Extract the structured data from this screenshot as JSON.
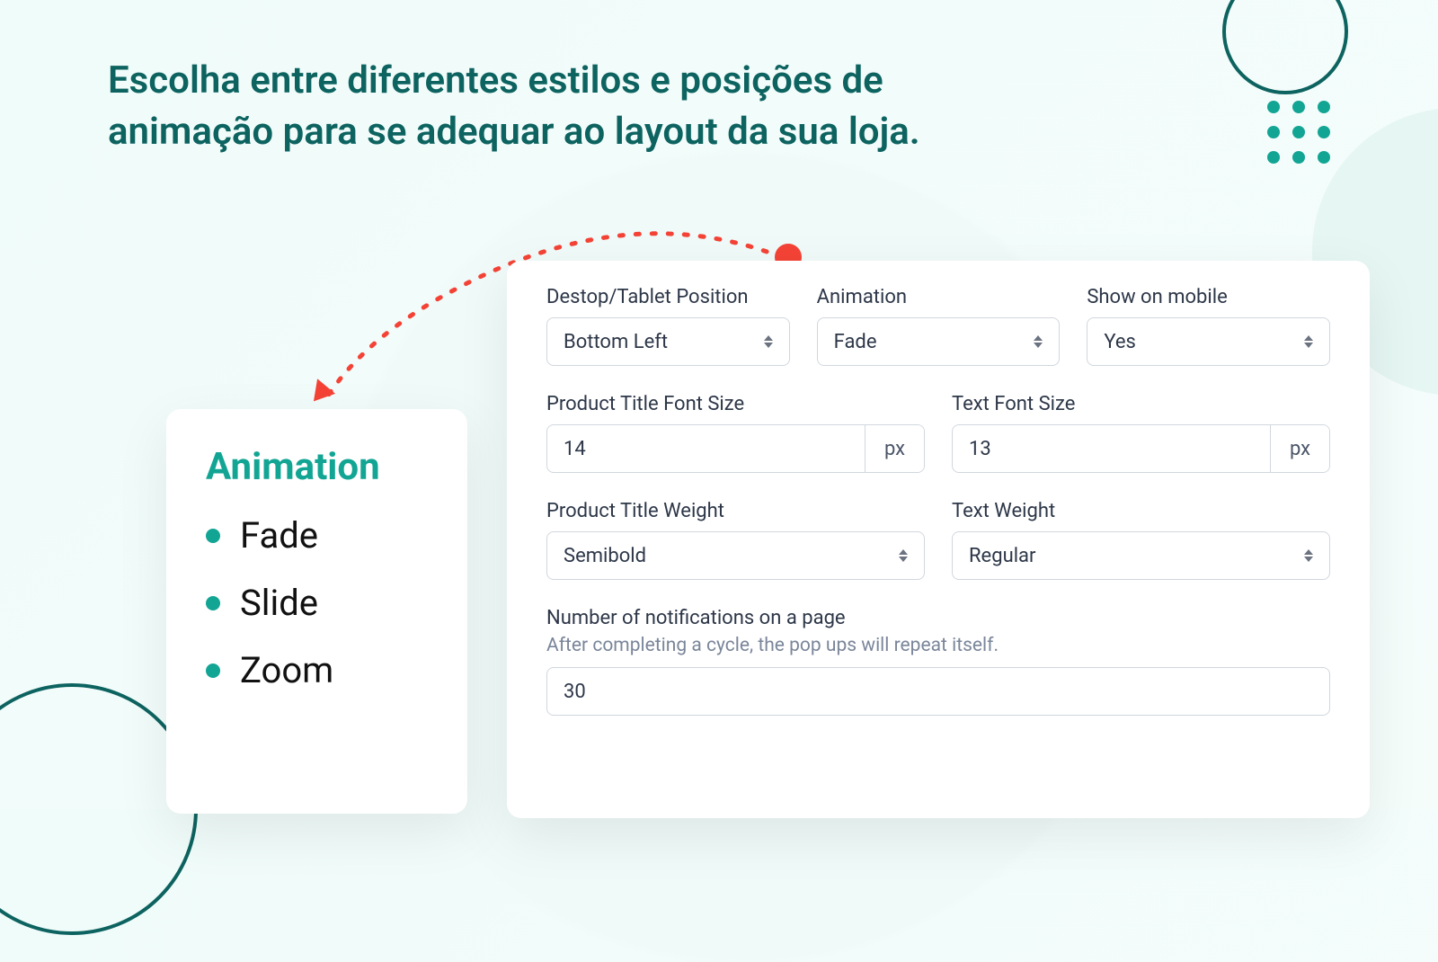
{
  "headline": "Escolha entre diferentes estilos e posições de animação para se adequar ao layout da sua loja.",
  "animation_card": {
    "title": "Animation",
    "options": [
      "Fade",
      "Slide",
      "Zoom"
    ]
  },
  "settings": {
    "position": {
      "label": "Destop/Tablet Position",
      "value": "Bottom Left"
    },
    "animation": {
      "label": "Animation",
      "value": "Fade"
    },
    "show_mobile": {
      "label": "Show on mobile",
      "value": "Yes"
    },
    "title_font_size": {
      "label": "Product Title Font Size",
      "value": "14",
      "unit": "px"
    },
    "text_font_size": {
      "label": "Text Font Size",
      "value": "13",
      "unit": "px"
    },
    "title_weight": {
      "label": "Product Title Weight",
      "value": "Semibold"
    },
    "text_weight": {
      "label": "Text Weight",
      "value": "Regular"
    },
    "notifications_count": {
      "label": "Number of notifications on a page",
      "help": "After completing a cycle, the pop ups will repeat itself.",
      "value": "30"
    }
  }
}
